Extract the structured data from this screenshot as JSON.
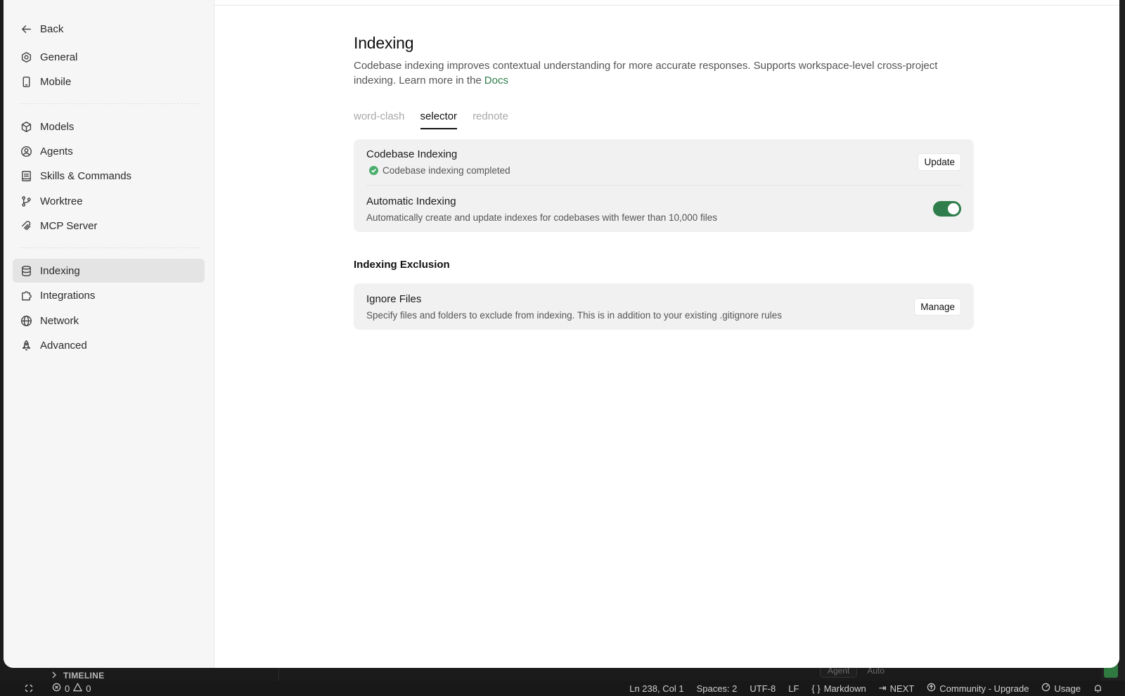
{
  "sidebar": {
    "back": "Back",
    "items": [
      {
        "label": "General",
        "icon": "gear-icon"
      },
      {
        "label": "Mobile",
        "icon": "mobile-icon"
      },
      {
        "label": "Models",
        "icon": "cube-icon"
      },
      {
        "label": "Agents",
        "icon": "agent-icon"
      },
      {
        "label": "Skills & Commands",
        "icon": "book-icon"
      },
      {
        "label": "Worktree",
        "icon": "branch-icon"
      },
      {
        "label": "MCP Server",
        "icon": "plug-icon"
      },
      {
        "label": "Indexing",
        "icon": "database-icon",
        "active": true
      },
      {
        "label": "Integrations",
        "icon": "puzzle-icon"
      },
      {
        "label": "Network",
        "icon": "globe-icon"
      },
      {
        "label": "Advanced",
        "icon": "rocket-icon"
      }
    ]
  },
  "page": {
    "title": "Indexing",
    "description": "Codebase indexing improves contextual understanding for more accurate responses. Supports workspace-level cross-project indexing. Learn more in the",
    "docs_link": "Docs",
    "tabs": [
      {
        "label": "word-clash",
        "active": false
      },
      {
        "label": "selector",
        "active": true
      },
      {
        "label": "rednote",
        "active": false
      }
    ]
  },
  "codebase_card": {
    "codebase_title": "Codebase Indexing",
    "codebase_status": "Codebase indexing completed",
    "update_button": "Update",
    "auto_title": "Automatic Indexing",
    "auto_desc": "Automatically create and update indexes for codebases with fewer than 10,000 files",
    "auto_enabled": true,
    "accent_color": "#2e7d4a"
  },
  "exclusion": {
    "section_title": "Indexing Exclusion",
    "ignore_title": "Ignore Files",
    "ignore_desc": "Specify files and folders to exclude from indexing. This is in addition to your existing .gitignore rules",
    "manage_button": "Manage"
  },
  "ide": {
    "timeline_label": "TIMELINE",
    "agent_label": "Agent",
    "auto_label": "Auto",
    "status": {
      "errors": "0",
      "warnings": "0",
      "cursor": "Ln 238, Col 1",
      "spaces": "Spaces: 2",
      "encoding": "UTF-8",
      "eol": "LF",
      "language": "Markdown",
      "next": "NEXT",
      "plan": "Community - Upgrade",
      "usage": "Usage"
    }
  }
}
